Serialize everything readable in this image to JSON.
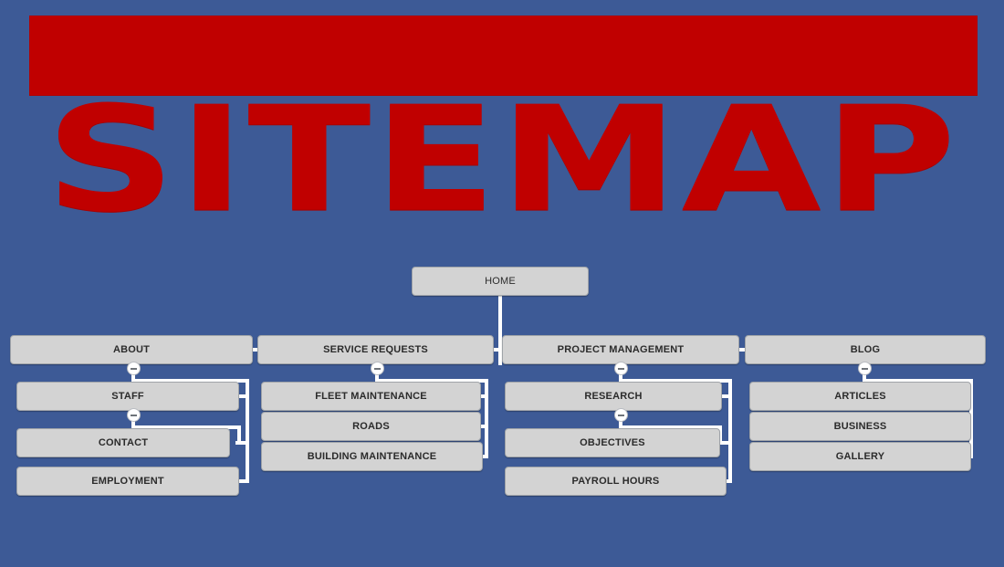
{
  "header": {
    "banner_color": "#c00000",
    "title": "SITEMAP"
  },
  "theme": {
    "background": "#3d5a96",
    "node_fill": "#d3d3d3",
    "node_border": "#9fa3a8",
    "connector": "#ffffff",
    "text": "#2b2b2b",
    "accent_red": "#c00000"
  },
  "diagram": {
    "type": "sitemap-tree",
    "root": {
      "label": "HOME"
    },
    "columns": [
      {
        "parent": {
          "label": "ABOUT"
        },
        "children": [
          {
            "label": "STAFF"
          },
          {
            "label": "CONTACT"
          },
          {
            "label": "EMPLOYMENT"
          }
        ]
      },
      {
        "parent": {
          "label": "SERVICE REQUESTS"
        },
        "children": [
          {
            "label": "FLEET MAINTENANCE"
          },
          {
            "label": "ROADS"
          },
          {
            "label": "BUILDING MAINTENANCE"
          }
        ]
      },
      {
        "parent": {
          "label": "PROJECT MANAGEMENT"
        },
        "children": [
          {
            "label": "RESEARCH"
          },
          {
            "label": "OBJECTIVES"
          },
          {
            "label": "PAYROLL HOURS"
          }
        ]
      },
      {
        "parent": {
          "label": "BLOG"
        },
        "children": [
          {
            "label": "ARTICLES"
          },
          {
            "label": "BUSINESS"
          },
          {
            "label": "GALLERY"
          }
        ]
      }
    ],
    "toggles": [
      {
        "state": "minus",
        "for": "ABOUT"
      },
      {
        "state": "minus",
        "for": "SERVICE REQUESTS"
      },
      {
        "state": "minus",
        "for": "PROJECT MANAGEMENT"
      },
      {
        "state": "minus",
        "for": "BLOG"
      },
      {
        "state": "minus",
        "for": "STAFF"
      },
      {
        "state": "minus",
        "for": "RESEARCH"
      }
    ]
  }
}
